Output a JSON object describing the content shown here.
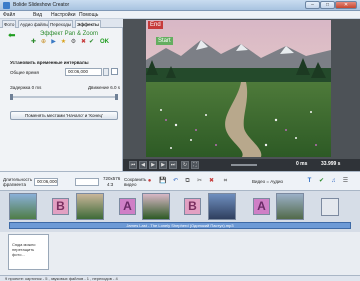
{
  "window": {
    "title": "Bolide Slideshow Creator",
    "buttons": {
      "min": "–",
      "max": "□",
      "close": "✕"
    }
  },
  "menu": {
    "items": [
      "Файл",
      "Вид",
      "Настройки",
      "Помощь"
    ]
  },
  "tabs": [
    "Фото",
    "Аудио файлы",
    "Переходы",
    "Эффекты"
  ],
  "effect": {
    "title": "Эффект Pan & Zoom",
    "ok_label": "OK",
    "section_title": "Установить временные интервалы",
    "total_time_label": "Общее время",
    "total_time_value": "00:06,000",
    "delay_label": "Задержка 0 ms",
    "motion_label": "Движение 6.0 s",
    "swap_button": "Поменять местами 'Начало' и 'Конец'",
    "slider_delay": 0.0,
    "slider_motion": 1.0
  },
  "preview": {
    "end_tag": "End",
    "start_tag": "Start"
  },
  "transport": {
    "time_left": "0 ms",
    "time_right": "33.999 s"
  },
  "timeline_toolbar": {
    "duration_label": "Длительность фрагмента",
    "duration_value": "00:06,000",
    "resolution_value": "720x576",
    "aspect_value": "4:3",
    "save_video_label": "Сохранить видео",
    "video_audio_label": "Видео = Аудио"
  },
  "timeline": {
    "transition_letters": [
      "B",
      "A",
      "B",
      "A"
    ],
    "audio_track": "James Last - The Lonely Shepherd (Одинокий Пастух).mp3"
  },
  "drop_hint": "Сюда можно перетащить фото...",
  "status": "9 проекте: картинок - 5 , звуковых файлов - 1 , переходов - 4",
  "colors": {
    "accent_green": "#2b8a2b",
    "tag_red": "#c63a3a",
    "audio_blue": "#6d9ad6"
  }
}
